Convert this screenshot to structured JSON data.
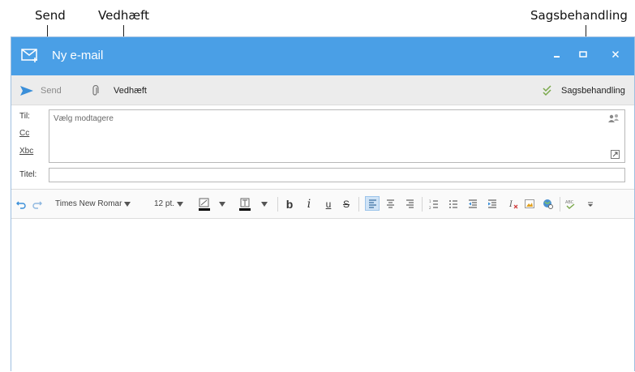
{
  "callouts": {
    "send": "Send",
    "attach": "Vedhæft",
    "case": "Sagsbehandling"
  },
  "window": {
    "title": "Ny e-mail",
    "minimize_label": "–",
    "maximize_label": "▫",
    "close_label": "×"
  },
  "toolbar": {
    "send_label": "Send",
    "attach_label": "Vedhæft",
    "case_label": "Sagsbehandling"
  },
  "fields": {
    "to_label": "Til:",
    "cc_label": "Cc",
    "bcc_label": "Xbc",
    "subject_label": "Titel:",
    "to_placeholder": "Vælg modtagere",
    "subject_value": ""
  },
  "format": {
    "font_family": "Times New Romar",
    "font_size": "12 pt.",
    "bold": "b",
    "italic": "i",
    "underline": "u",
    "strike": "S"
  },
  "colors": {
    "titlebar": "#4a9fe6",
    "accent": "#3b8fd9",
    "highlight_color": "#f0c000",
    "font_color": "#000000"
  }
}
